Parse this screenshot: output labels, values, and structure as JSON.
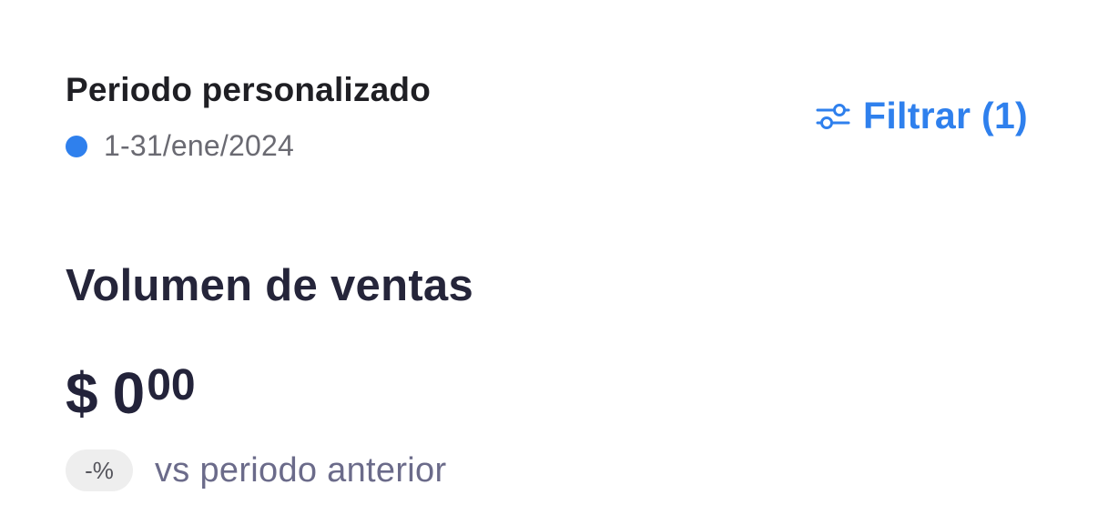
{
  "period": {
    "title": "Periodo personalizado",
    "date_range": "1-31/ene/2024",
    "dot_color": "#2f80ed"
  },
  "filter": {
    "label": "Filtrar (1)",
    "icon": "sliders-icon",
    "color": "#2f80ed"
  },
  "sales": {
    "title": "Volumen de ventas",
    "currency": "$",
    "integer": "0",
    "cents": "00",
    "change_badge": "-%",
    "comparison_text": "vs periodo anterior"
  }
}
